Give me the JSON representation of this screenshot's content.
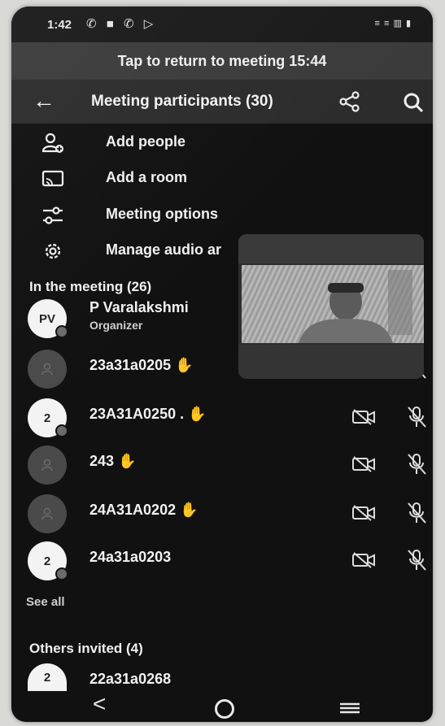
{
  "status_bar": {
    "time": "1:42",
    "notification_icons": "✆ ■ ✆ ▷",
    "right": "≡ ≡ ▥ ▮"
  },
  "banner": {
    "text": "Tap to return to meeting 15:44"
  },
  "header": {
    "title": "Meeting participants (30)"
  },
  "menu": [
    {
      "label": "Add people",
      "icon": "add-person-icon"
    },
    {
      "label": "Add a room",
      "icon": "cast-room-icon"
    },
    {
      "label": "Meeting options",
      "icon": "sliders-icon"
    },
    {
      "label": "Manage audio ar",
      "icon": "gear-icon"
    }
  ],
  "in_meeting": {
    "title": "In the meeting (26)",
    "participants": [
      {
        "avatar": "PV",
        "name": "P Varalakshmi",
        "role": "Organizer"
      },
      {
        "avatar": "",
        "name": "23a31a0205 ✋"
      },
      {
        "avatar": "2",
        "name": "23A31A0250 . ✋"
      },
      {
        "avatar": "",
        "name": "243 ✋"
      },
      {
        "avatar": "",
        "name": "24A31A0202 ✋"
      },
      {
        "avatar": "2",
        "name": "24a31a0203"
      }
    ],
    "see_all": "See all"
  },
  "others_invited": {
    "title": "Others invited (4)",
    "participants": [
      {
        "avatar": "2",
        "name": "22a31a0268"
      }
    ]
  },
  "nav": {
    "back": "<"
  },
  "colors": {
    "background": "#111111",
    "header": "#2c2c2c",
    "banner": "#3b3b3b"
  }
}
